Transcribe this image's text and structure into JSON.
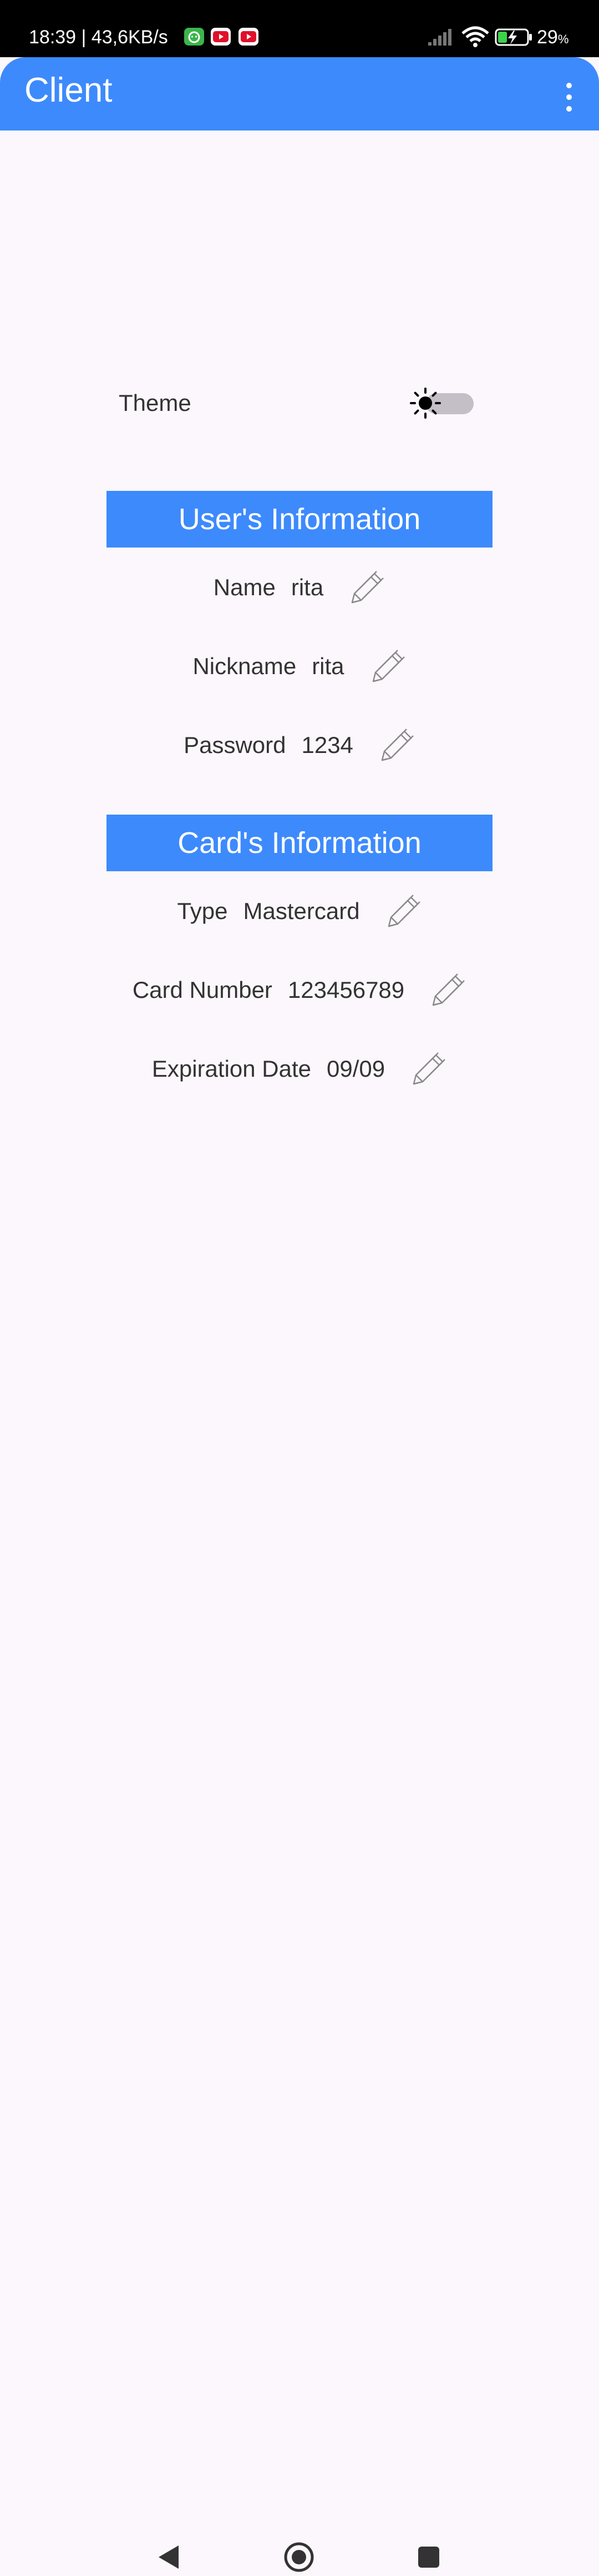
{
  "status_bar": {
    "time_speed": "18:39 | 43,6KB/s",
    "battery_percent": "29",
    "battery_unit": "%"
  },
  "app_bar": {
    "title": "Client"
  },
  "theme": {
    "label": "Theme"
  },
  "users_section": {
    "title": "User's Information",
    "rows": [
      {
        "label": "Name",
        "value": "rita"
      },
      {
        "label": "Nickname",
        "value": "rita"
      },
      {
        "label": "Password",
        "value": "1234"
      }
    ]
  },
  "cards_section": {
    "title": "Card's Information",
    "rows": [
      {
        "label": "Type",
        "value": "Mastercard"
      },
      {
        "label": "Card Number",
        "value": "123456789"
      },
      {
        "label": "Expiration Date",
        "value": "09/09"
      }
    ]
  },
  "colors": {
    "accent": "#3d8afd",
    "background": "#fcf7fc",
    "text": "#333333"
  },
  "icons": [
    "overflow-menu-icon",
    "sun-icon",
    "edit-pencil-icon",
    "back-icon",
    "home-icon",
    "recents-icon",
    "wifi-icon",
    "signal-icon",
    "battery-icon"
  ]
}
